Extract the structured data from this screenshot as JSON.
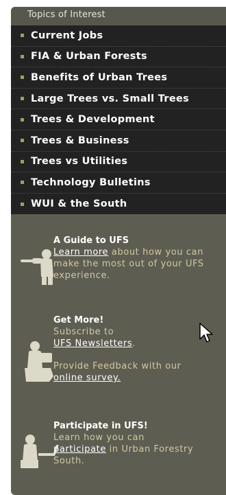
{
  "topics": {
    "title": "Topics of Interest",
    "items": [
      {
        "label": "Current Jobs"
      },
      {
        "label": "FIA & Urban Forests"
      },
      {
        "label": "Benefits of Urban Trees"
      },
      {
        "label": "Large Trees vs. Small Trees"
      },
      {
        "label": "Trees & Development"
      },
      {
        "label": "Trees & Business"
      },
      {
        "label": "Trees vs Utilities"
      },
      {
        "label": "Technology Bulletins"
      },
      {
        "label": "WUI & the South"
      }
    ]
  },
  "guide": {
    "title": "A Guide to UFS",
    "link": "Learn more",
    "text_after": " about how you can make the most out of your UFS experience."
  },
  "getmore": {
    "title": "Get More!",
    "subscribe_text": "Subscribe to",
    "newsletters_link": "UFS Newsletters",
    "newsletters_after": ".",
    "feedback_text": "Provide Feedback with our",
    "survey_link": "online survey."
  },
  "participate": {
    "title": "Participate in UFS!",
    "text_before": "Learn how you can",
    "link": "participate",
    "text_after": " in Urban Forestry South."
  },
  "colors": {
    "panel": "#5d5d52",
    "list_background": "#222222",
    "bullet": "#9f9f62",
    "promo_text": "#d2c9a0"
  }
}
